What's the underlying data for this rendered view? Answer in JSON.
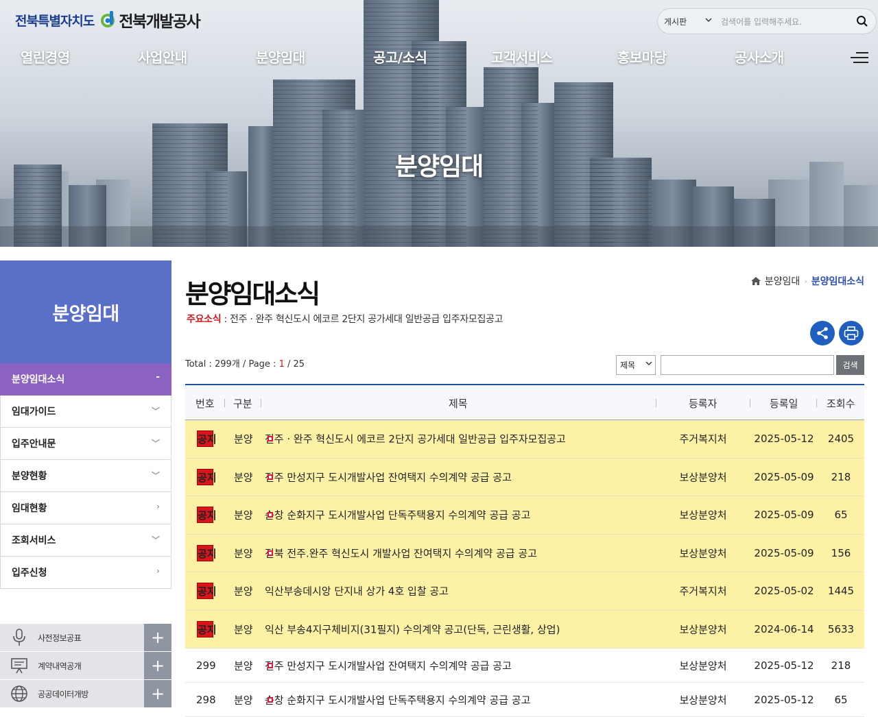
{
  "header": {
    "logo_province": "전북특별자치도",
    "logo_corp": "전북개발공사",
    "search": {
      "scope": "게시판",
      "placeholder": "검색어를 입력해주세요."
    },
    "nav": [
      "열린경영",
      "사업안내",
      "분양임대",
      "공고/소식",
      "고객서비스",
      "홍보마당",
      "공사소개"
    ],
    "hero_title": "분양임대"
  },
  "sidebar": {
    "title": "분양임대",
    "items": [
      {
        "label": "분양임대소식",
        "icon": "minus"
      },
      {
        "label": "임대가이드",
        "icon": "chevron-down"
      },
      {
        "label": "입주안내문",
        "icon": "chevron-down"
      },
      {
        "label": "분양현황",
        "icon": "chevron-down"
      },
      {
        "label": "임대현황",
        "icon": "chevron-right"
      },
      {
        "label": "조회서비스",
        "icon": "chevron-down"
      },
      {
        "label": "입주신청",
        "icon": "chevron-right"
      }
    ],
    "quick": [
      {
        "label": "사전정보공표",
        "icon": "microphone-icon"
      },
      {
        "label": "계약내역공개",
        "icon": "presentation-icon"
      },
      {
        "label": "공공데이터개방",
        "icon": "globe-icon"
      }
    ]
  },
  "content": {
    "title": "분양임대소식",
    "breadcrumb": {
      "parent": "분양임대",
      "current": "분양임대소식"
    },
    "notice": {
      "label": "주요소식",
      "sep": " : ",
      "text": "전주 · 완주 혁신도시 에코르 2단지 공가세대 일반공급 입주자모집공고"
    },
    "total": {
      "prefix": "Total : ",
      "count": "299개",
      "page_prefix": " / Page : ",
      "page": "1",
      "pages": " / 25"
    },
    "filter": {
      "field": "제목",
      "button": "검색"
    },
    "columns": [
      "번호",
      "구분",
      "제목",
      "등록자",
      "등록일",
      "조회수"
    ],
    "badge": "공지",
    "rows": [
      {
        "no": "",
        "notice": true,
        "cat": "분양",
        "title": "전주 · 완주 혁신도시 에코르 2단지 공가세대 일반공급 입주자모집공고",
        "new": true,
        "writer": "주거복지처",
        "date": "2025-05-12",
        "views": "2405"
      },
      {
        "no": "",
        "notice": true,
        "cat": "분양",
        "title": "전주 만성지구 도시개발사업 잔여택지 수의계약 공급 공고",
        "new": true,
        "writer": "보상분양처",
        "date": "2025-05-09",
        "views": "218"
      },
      {
        "no": "",
        "notice": true,
        "cat": "분양",
        "title": "순창 순화지구 도시개발사업 단독주택용지 수의계약 공급 공고",
        "new": true,
        "writer": "보상분양처",
        "date": "2025-05-09",
        "views": "65"
      },
      {
        "no": "",
        "notice": true,
        "cat": "분양",
        "title": "전북 전주.완주 혁신도시 개발사업 잔여택지 수의계약 공급 공고",
        "new": true,
        "writer": "보상분양처",
        "date": "2025-05-09",
        "views": "156"
      },
      {
        "no": "",
        "notice": true,
        "cat": "분양",
        "title": "익산부송데시앙 단지내 상가 4호 입찰 공고",
        "new": false,
        "writer": "주거복지처",
        "date": "2025-05-02",
        "views": "1445"
      },
      {
        "no": "",
        "notice": true,
        "cat": "분양",
        "title": "익산 부송4지구체비지(31필지) 수의계약 공고(단독, 근린생활, 상업)",
        "new": false,
        "writer": "보상분양처",
        "date": "2024-06-14",
        "views": "5633"
      },
      {
        "no": "299",
        "notice": false,
        "cat": "분양",
        "title": "전주 만성지구 도시개발사업 잔여택지 수의계약 공급 공고",
        "new": true,
        "writer": "보상분양처",
        "date": "2025-05-12",
        "views": "218"
      },
      {
        "no": "298",
        "notice": false,
        "cat": "분양",
        "title": "순창 순화지구 도시개발사업 단독주택용지 수의계약 공급 공고",
        "new": true,
        "writer": "보상분양처",
        "date": "2025-05-12",
        "views": "65"
      }
    ]
  },
  "colors": {
    "accent": "#5a6fc8",
    "active": "#8b62c2",
    "notice_bg": "#fdf1a6",
    "badge": "#d8141d",
    "primary": "#1f5fbf"
  }
}
